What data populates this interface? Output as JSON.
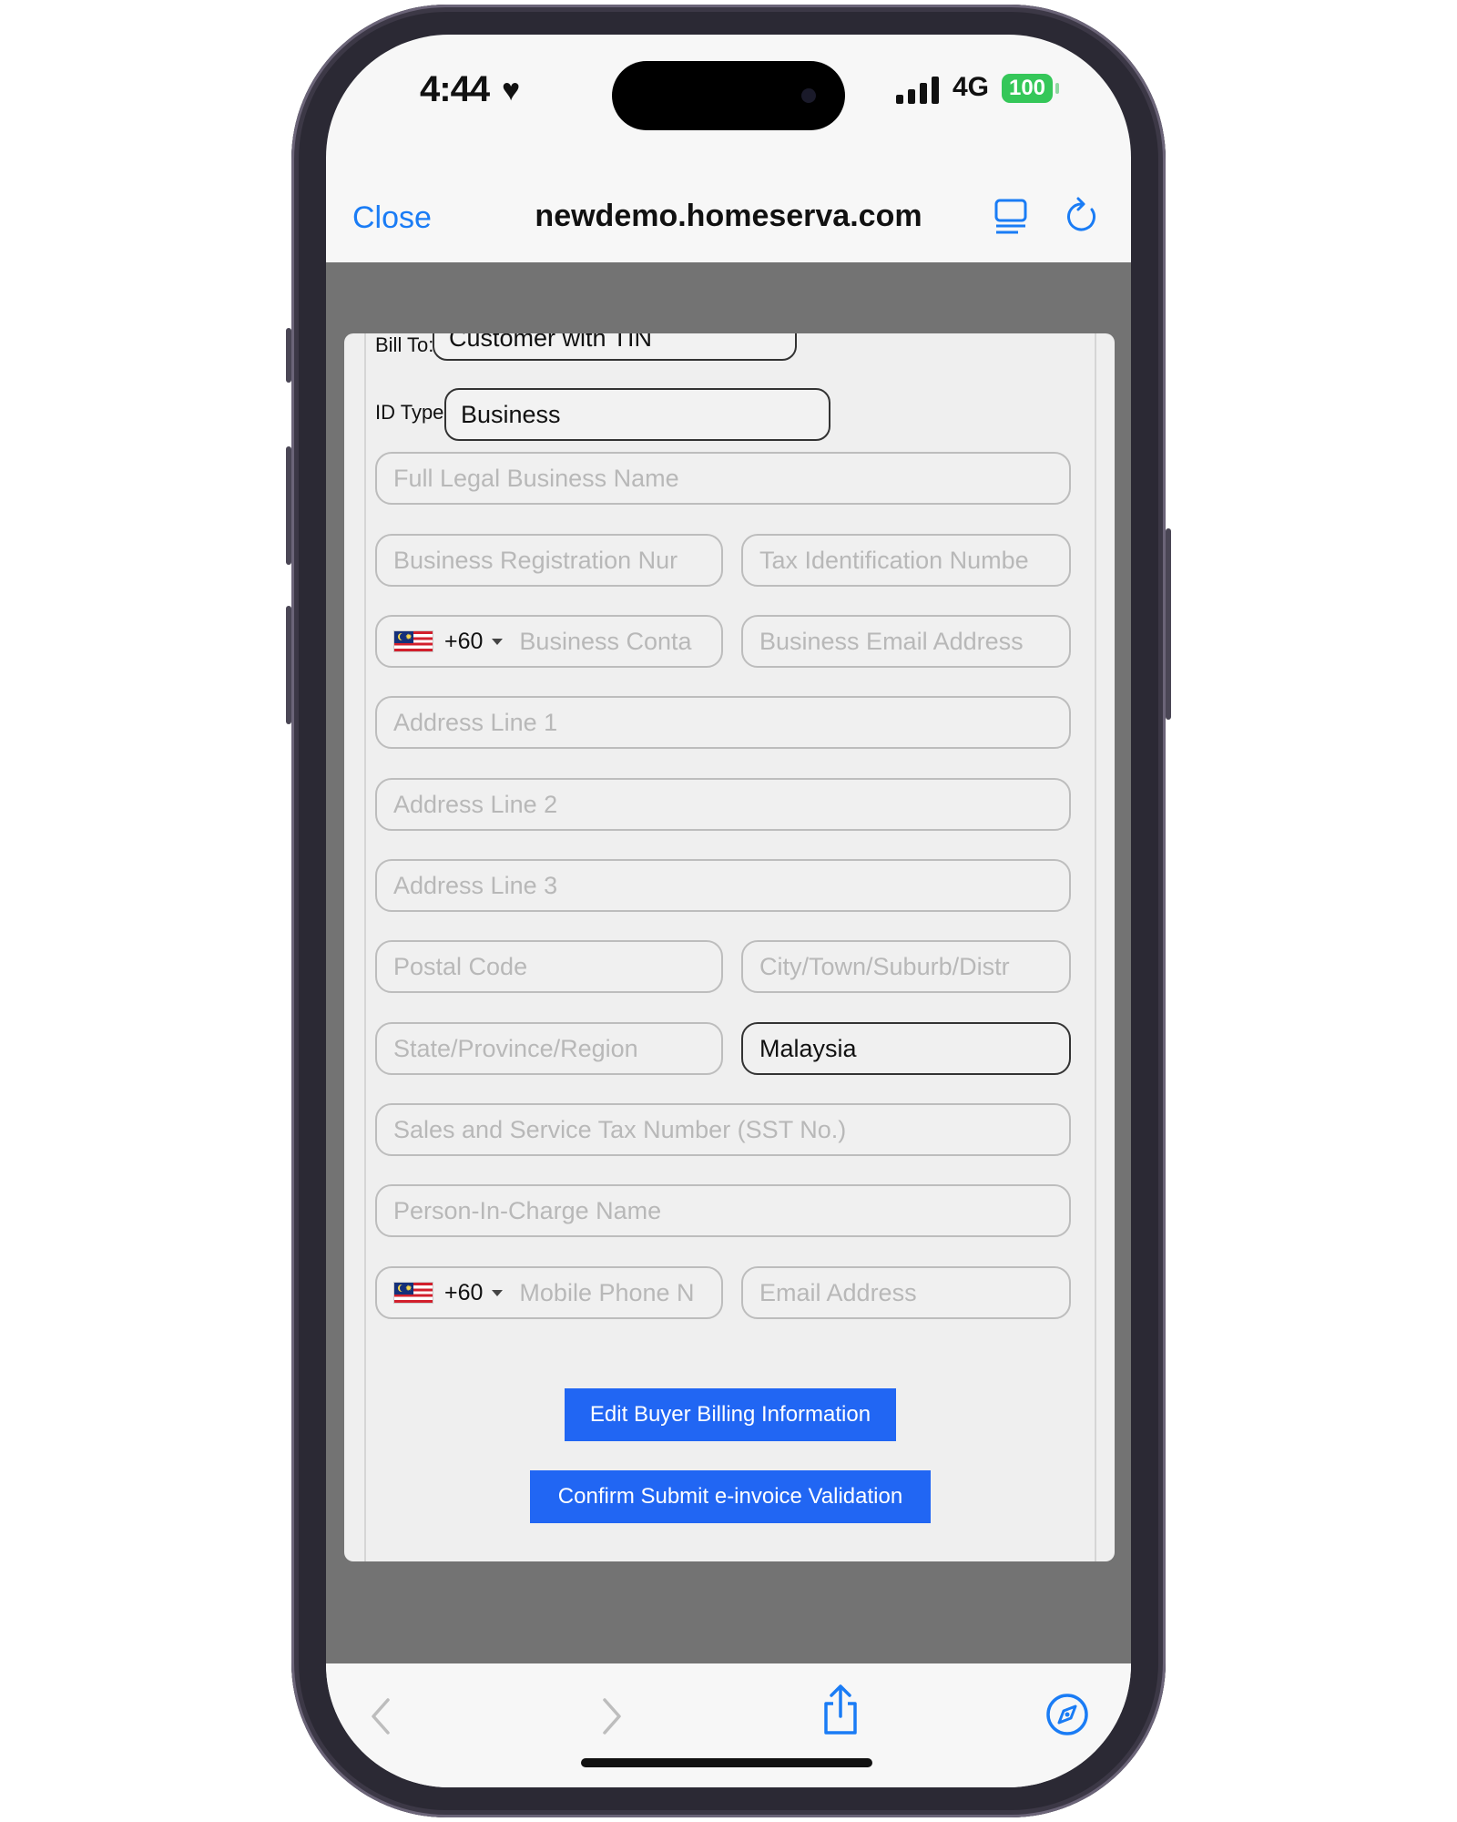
{
  "status_bar": {
    "time": "4:44",
    "network": "4G",
    "battery": "100"
  },
  "browser": {
    "close_label": "Close",
    "url": "newdemo.homeserva.com"
  },
  "form": {
    "bill_to_label": "Bill To:",
    "bill_to_value": "Customer with TIN",
    "id_type_label": "ID Type:",
    "id_type_value": "Business",
    "fields": {
      "legal_name": "Full Legal Business Name",
      "reg_number": "Business Registration Nur",
      "tin": "Tax Identification Numbe",
      "phone_code": "+60",
      "business_contact": "Business Conta",
      "business_email": "Business Email Address",
      "address1": "Address Line 1",
      "address2": "Address Line 2",
      "address3": "Address Line 3",
      "postal": "Postal Code",
      "city": "City/Town/Suburb/Distr",
      "state": "State/Province/Region",
      "country": "Malaysia",
      "sst": "Sales and Service Tax Number (SST No.)",
      "pic_name": "Person-In-Charge Name",
      "mobile_code": "+60",
      "mobile": "Mobile Phone N",
      "email": "Email Address"
    },
    "edit_button": "Edit Buyer Billing Information",
    "confirm_button": "Confirm Submit e-invoice Validation"
  },
  "colors": {
    "accent": "#2166f3",
    "link": "#1a7cf5",
    "battery": "#35c759"
  }
}
